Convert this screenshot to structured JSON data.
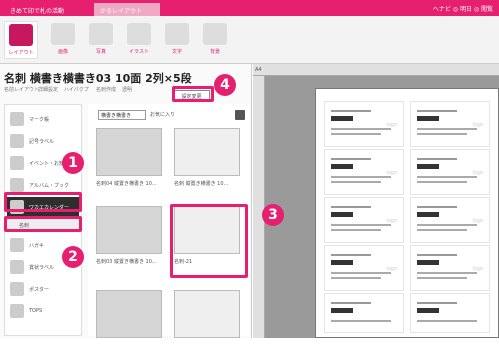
{
  "titlebar": {
    "tabs": [
      {
        "label": "きめて印で札の活動"
      },
      {
        "label": "かるレイアウト"
      }
    ],
    "right_text": "ヘナビ ◎ 明日 ◎ 閲覧"
  },
  "ribbon": {
    "buttons": [
      {
        "label": "レイアウト",
        "icon": "layout-icon"
      },
      {
        "label": "画像",
        "icon": "image-icon"
      },
      {
        "label": "写真",
        "icon": "photo-icon"
      },
      {
        "label": "イラスト",
        "icon": "illustration-icon"
      },
      {
        "label": "文字",
        "icon": "text-icon"
      },
      {
        "label": "背景",
        "icon": "background-icon"
      }
    ]
  },
  "document": {
    "title": "名刺  横書き横書き03  10面 2列×5段"
  },
  "toolbar2": {
    "items": [
      "名前レイアウト",
      "詳細設定",
      "ハイパクプ",
      "名刺作成",
      "透明"
    ],
    "settings_button": "設定変更"
  },
  "categories": [
    {
      "label": "マーク帳",
      "icon": "notebook-icon"
    },
    {
      "label": "記号ラベル",
      "icon": "label-icon"
    },
    {
      "label": "イベント・お知らせ",
      "icon": "event-icon"
    },
    {
      "label": "アルバム・ブック",
      "icon": "album-icon"
    },
    {
      "label": "ワカエカレンダー",
      "icon": "calendar-icon"
    },
    {
      "label": "名刺",
      "icon": "card-icon"
    },
    {
      "label": "ハガキ",
      "icon": "postcard-icon"
    },
    {
      "label": "賞状ラベル",
      "icon": "award-icon"
    },
    {
      "label": "ポスター",
      "icon": "poster-icon"
    },
    {
      "label": "TOPS",
      "icon": "tops-icon"
    }
  ],
  "gallery": {
    "dropdown": "横書き横書き",
    "favorites": "お気に入り",
    "thumbs": [
      {
        "caption": "名刺04  縦置き横書き 10..."
      },
      {
        "caption": "名刺 縦置き横書き 10..."
      },
      {
        "caption": "名刺03  縦置き横書き 10..."
      },
      {
        "caption": "名刺-21"
      },
      {
        "caption": ""
      },
      {
        "caption": ""
      }
    ]
  },
  "canvas": {
    "ruler_label": "A4",
    "card_logo": "logo"
  },
  "annotations": [
    "1",
    "2",
    "3",
    "4"
  ],
  "colors": {
    "accent": "#e61f6f",
    "selected_dark": "#2e2e2e"
  }
}
